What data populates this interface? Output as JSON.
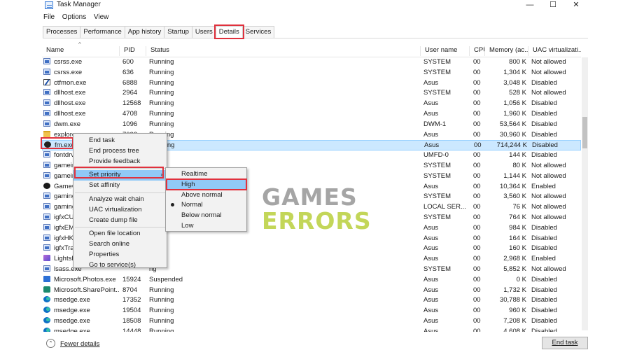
{
  "window": {
    "title": "Task Manager",
    "controls": {
      "minimize": "—",
      "maximize": "☐",
      "close": "✕"
    }
  },
  "menu": [
    "File",
    "Options",
    "View"
  ],
  "tabs": [
    {
      "label": "Processes",
      "active": false
    },
    {
      "label": "Performance",
      "active": false
    },
    {
      "label": "App history",
      "active": false
    },
    {
      "label": "Startup",
      "active": false
    },
    {
      "label": "Users",
      "active": false
    },
    {
      "label": "Details",
      "active": true
    },
    {
      "label": "Services",
      "active": false
    }
  ],
  "columns": {
    "name": "Name",
    "pid": "PID",
    "status": "Status",
    "user": "User name",
    "cpu": "CPU",
    "memory": "Memory (ac...",
    "uac": "UAC virtualizati..."
  },
  "rows": [
    {
      "icon": "exe-icon",
      "name": "csrss.exe",
      "pid": "600",
      "status": "Running",
      "user": "SYSTEM",
      "cpu": "00",
      "memory": "800 K",
      "uac": "Not allowed"
    },
    {
      "icon": "exe-icon",
      "name": "csrss.exe",
      "pid": "636",
      "status": "Running",
      "user": "SYSTEM",
      "cpu": "00",
      "memory": "1,304 K",
      "uac": "Not allowed"
    },
    {
      "icon": "ctfmon-icon",
      "name": "ctfmon.exe",
      "pid": "6888",
      "status": "Running",
      "user": "Asus",
      "cpu": "00",
      "memory": "3,048 K",
      "uac": "Disabled"
    },
    {
      "icon": "exe-icon",
      "name": "dllhost.exe",
      "pid": "2964",
      "status": "Running",
      "user": "SYSTEM",
      "cpu": "00",
      "memory": "528 K",
      "uac": "Not allowed"
    },
    {
      "icon": "exe-icon",
      "name": "dllhost.exe",
      "pid": "12568",
      "status": "Running",
      "user": "Asus",
      "cpu": "00",
      "memory": "1,056 K",
      "uac": "Disabled"
    },
    {
      "icon": "exe-icon",
      "name": "dllhost.exe",
      "pid": "4708",
      "status": "Running",
      "user": "Asus",
      "cpu": "00",
      "memory": "1,960 K",
      "uac": "Disabled"
    },
    {
      "icon": "exe-icon",
      "name": "dwm.exe",
      "pid": "1096",
      "status": "Running",
      "user": "DWM-1",
      "cpu": "00",
      "memory": "53,564 K",
      "uac": "Disabled"
    },
    {
      "icon": "folder-icon",
      "name": "explorer.exe",
      "pid": "7092",
      "status": "Running",
      "user": "Asus",
      "cpu": "00",
      "memory": "30,960 K",
      "uac": "Disabled"
    },
    {
      "icon": "fm-icon",
      "name": "fm.exe",
      "pid": "",
      "status": "Running",
      "user": "Asus",
      "cpu": "00",
      "memory": "714,244 K",
      "uac": "Disabled",
      "selected": true
    },
    {
      "icon": "exe-icon",
      "name": "fontdrvhost.exe",
      "pid": "",
      "status": "",
      "user": "UMFD-0",
      "cpu": "00",
      "memory": "144 K",
      "uac": "Disabled"
    },
    {
      "icon": "exe-icon",
      "name": "gameinputsvc.exe",
      "pid": "",
      "status": "",
      "user": "SYSTEM",
      "cpu": "00",
      "memory": "80 K",
      "uac": "Not allowed"
    },
    {
      "icon": "exe-icon",
      "name": "gameinputsvc.exe",
      "pid": "",
      "status": "",
      "user": "SYSTEM",
      "cpu": "00",
      "memory": "1,144 K",
      "uac": "Not allowed"
    },
    {
      "icon": "game-icon",
      "name": "GameCenter.exe",
      "pid": "",
      "status": "",
      "user": "Asus",
      "cpu": "00",
      "memory": "10,364 K",
      "uac": "Enabled"
    },
    {
      "icon": "exe-icon",
      "name": "gaming_service.exe",
      "pid": "",
      "status": "",
      "user": "SYSTEM",
      "cpu": "00",
      "memory": "3,560 K",
      "uac": "Not allowed"
    },
    {
      "icon": "exe-icon",
      "name": "gamingservices.exe",
      "pid": "",
      "status": "",
      "user": "LOCAL SER...",
      "cpu": "00",
      "memory": "76 K",
      "uac": "Not allowed"
    },
    {
      "icon": "exe-icon",
      "name": "igfxCUIService.exe",
      "pid": "",
      "status": "",
      "user": "SYSTEM",
      "cpu": "00",
      "memory": "764 K",
      "uac": "Not allowed"
    },
    {
      "icon": "exe-icon",
      "name": "igfxEM.exe",
      "pid": "",
      "status": "",
      "user": "Asus",
      "cpu": "00",
      "memory": "984 K",
      "uac": "Disabled"
    },
    {
      "icon": "exe-icon",
      "name": "igfxHK.exe",
      "pid": "",
      "status": "ng",
      "user": "Asus",
      "cpu": "00",
      "memory": "164 K",
      "uac": "Disabled"
    },
    {
      "icon": "exe-icon",
      "name": "igfxTray.exe",
      "pid": "",
      "status": "ng",
      "user": "Asus",
      "cpu": "00",
      "memory": "160 K",
      "uac": "Disabled"
    },
    {
      "icon": "lightshot-icon",
      "name": "Lightshot.exe",
      "pid": "",
      "status": "ng",
      "user": "Asus",
      "cpu": "00",
      "memory": "2,968 K",
      "uac": "Enabled"
    },
    {
      "icon": "exe-icon",
      "name": "lsass.exe",
      "pid": "",
      "status": "ng",
      "user": "SYSTEM",
      "cpu": "00",
      "memory": "5,852 K",
      "uac": "Not allowed"
    },
    {
      "icon": "photos-icon",
      "name": "Microsoft.Photos.exe",
      "pid": "15924",
      "status": "Suspended",
      "user": "Asus",
      "cpu": "00",
      "memory": "0 K",
      "uac": "Disabled"
    },
    {
      "icon": "sharepoint-icon",
      "name": "Microsoft.SharePoint....",
      "pid": "8704",
      "status": "Running",
      "user": "Asus",
      "cpu": "00",
      "memory": "1,732 K",
      "uac": "Disabled"
    },
    {
      "icon": "edge-icon",
      "name": "msedge.exe",
      "pid": "17352",
      "status": "Running",
      "user": "Asus",
      "cpu": "00",
      "memory": "30,788 K",
      "uac": "Disabled"
    },
    {
      "icon": "edge-icon",
      "name": "msedge.exe",
      "pid": "19504",
      "status": "Running",
      "user": "Asus",
      "cpu": "00",
      "memory": "960 K",
      "uac": "Disabled"
    },
    {
      "icon": "edge-icon",
      "name": "msedge.exe",
      "pid": "18508",
      "status": "Running",
      "user": "Asus",
      "cpu": "00",
      "memory": "7,208 K",
      "uac": "Disabled"
    },
    {
      "icon": "edge-icon",
      "name": "msedge.exe",
      "pid": "14448",
      "status": "Running",
      "user": "Asus",
      "cpu": "00",
      "memory": "4,608 K",
      "uac": "Disabled"
    }
  ],
  "context_menu": {
    "items": [
      {
        "label": "End task"
      },
      {
        "label": "End process tree"
      },
      {
        "label": "Provide feedback"
      },
      {
        "separator": true
      },
      {
        "label": "Set priority",
        "submenu": true,
        "highlighted": true
      },
      {
        "label": "Set affinity"
      },
      {
        "separator": true
      },
      {
        "label": "Analyze wait chain"
      },
      {
        "label": "UAC virtualization"
      },
      {
        "label": "Create dump file"
      },
      {
        "separator": true
      },
      {
        "label": "Open file location"
      },
      {
        "label": "Search online"
      },
      {
        "label": "Properties"
      },
      {
        "label": "Go to service(s)"
      }
    ]
  },
  "priority_submenu": {
    "items": [
      {
        "label": "Realtime"
      },
      {
        "label": "High",
        "highlighted": true
      },
      {
        "label": "Above normal"
      },
      {
        "label": "Normal",
        "checked": true
      },
      {
        "label": "Below normal"
      },
      {
        "label": "Low"
      }
    ]
  },
  "watermark": {
    "line1": "GAMES",
    "line2": "ERRORS",
    "color1": "#8c8c8c",
    "color2": "#b9cf3d"
  },
  "footer": {
    "fewer_details": "Fewer details",
    "end_task": "End task"
  },
  "accent_colors": {
    "highlight_box": "#e0313d",
    "selection": "#cce8ff",
    "menu_highlight": "#91c9f7"
  }
}
